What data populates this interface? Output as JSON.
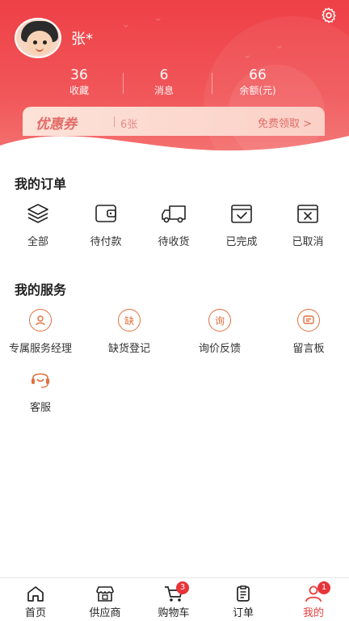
{
  "profile": {
    "username": "张*",
    "stats": [
      {
        "value": "36",
        "label": "收藏"
      },
      {
        "value": "6",
        "label": "消息"
      },
      {
        "value": "66",
        "label": "余额(元)"
      }
    ]
  },
  "coupon": {
    "title": "优惠券",
    "count": "6张",
    "action": "免费领取 >"
  },
  "orders": {
    "title": "我的订单",
    "items": [
      {
        "label": "全部",
        "icon": "layers-icon"
      },
      {
        "label": "待付款",
        "icon": "wallet-icon"
      },
      {
        "label": "待收货",
        "icon": "truck-icon"
      },
      {
        "label": "已完成",
        "icon": "check-box-icon"
      },
      {
        "label": "已取消",
        "icon": "cancel-box-icon"
      }
    ]
  },
  "services": {
    "title": "我的服务",
    "items": [
      {
        "label": "专属服务经理",
        "icon": "manager-icon",
        "glyph": ""
      },
      {
        "label": "缺货登记",
        "icon": "out-of-stock-icon",
        "glyph": "缺"
      },
      {
        "label": "询价反馈",
        "icon": "inquiry-icon",
        "glyph": "询"
      },
      {
        "label": "留言板",
        "icon": "message-board-icon",
        "glyph": ""
      },
      {
        "label": "客服",
        "icon": "headset-icon",
        "glyph": ""
      }
    ]
  },
  "tabbar": {
    "items": [
      {
        "label": "首页",
        "icon": "home-icon"
      },
      {
        "label": "供应商",
        "icon": "store-icon"
      },
      {
        "label": "购物车",
        "icon": "cart-icon",
        "badge": "3"
      },
      {
        "label": "订单",
        "icon": "order-list-icon"
      },
      {
        "label": "我的",
        "icon": "user-icon",
        "badge": "1",
        "active": true
      }
    ]
  },
  "colors": {
    "header": "#ee4046",
    "accent": "#e8403f",
    "service_icon": "#e0703e"
  }
}
